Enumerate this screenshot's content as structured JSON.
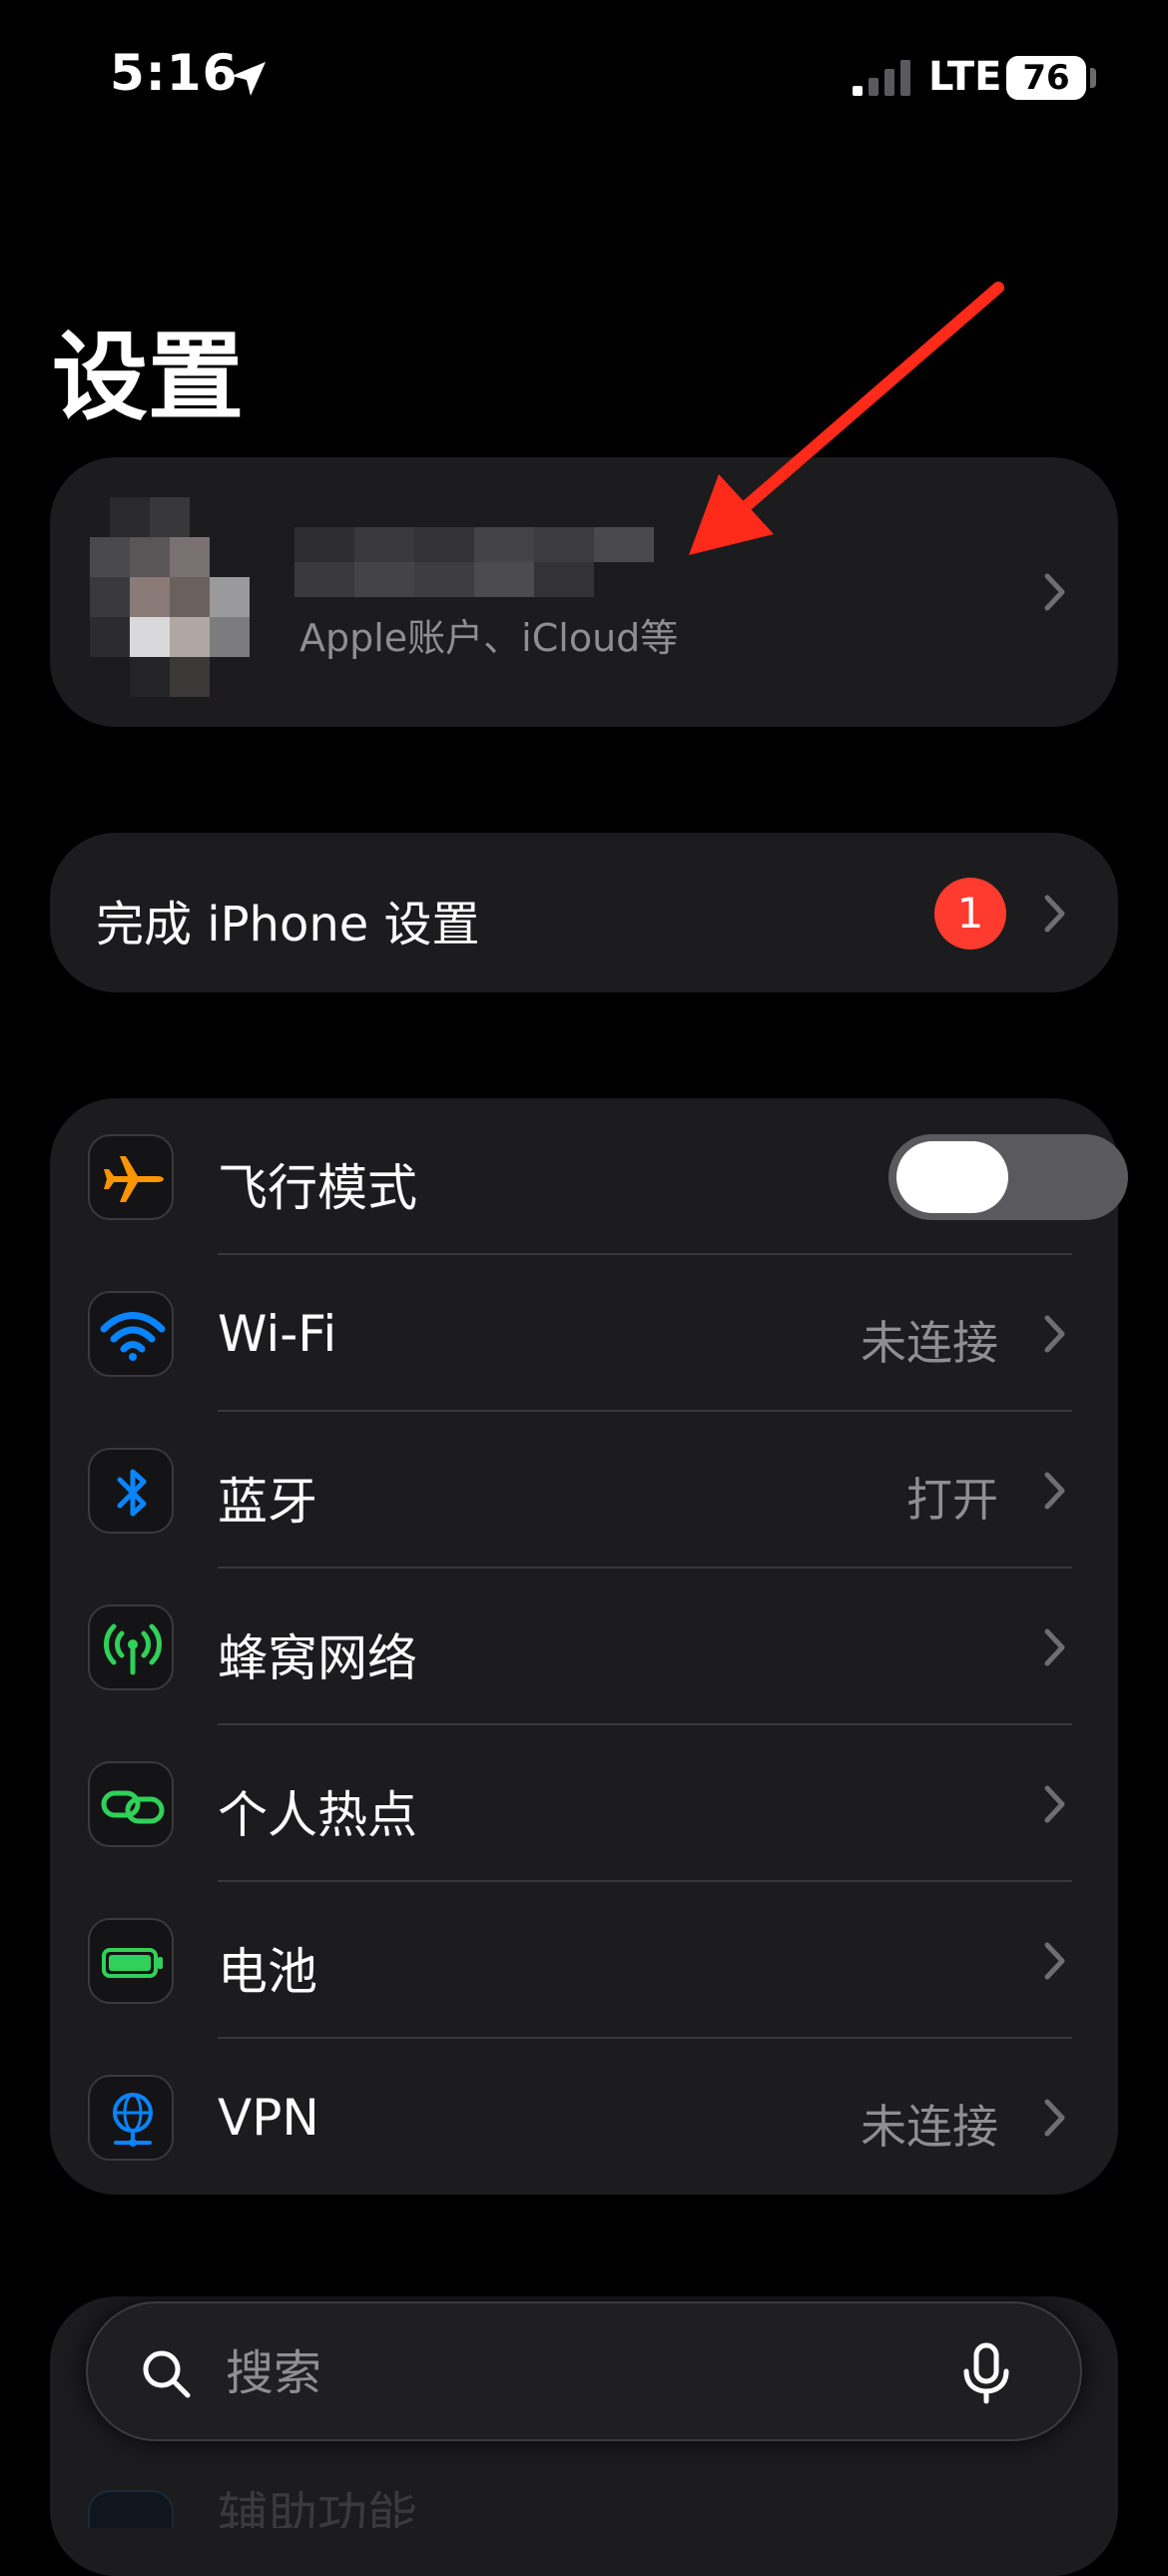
{
  "status_bar": {
    "time": "5:16",
    "network": "LTE",
    "battery_level": "76",
    "location_icon": "location-arrow-icon",
    "signal_icon": "cellular-signal-icon"
  },
  "header": {
    "title": "设置"
  },
  "account": {
    "subtitle": "Apple账户、iCloud等",
    "avatar_icon": "avatar-pixelated"
  },
  "setup": {
    "label": "完成 iPhone 设置",
    "badge_count": "1"
  },
  "settings": {
    "airplane": {
      "label": "飞行模式",
      "icon": "airplane-icon",
      "enabled": false
    },
    "wifi": {
      "label": "Wi-Fi",
      "value": "未连接",
      "icon": "wifi-icon"
    },
    "bluetooth": {
      "label": "蓝牙",
      "value": "打开",
      "icon": "bluetooth-icon"
    },
    "cellular": {
      "label": "蜂窝网络",
      "icon": "cellular-antenna-icon"
    },
    "hotspot": {
      "label": "个人热点",
      "icon": "hotspot-link-icon"
    },
    "battery": {
      "label": "电池",
      "icon": "battery-icon"
    },
    "vpn": {
      "label": "VPN",
      "value": "未连接",
      "icon": "vpn-globe-icon"
    }
  },
  "search": {
    "placeholder": "搜索",
    "search_icon": "search-icon",
    "mic_icon": "microphone-icon"
  },
  "partially_visible": {
    "label": "辅助功能"
  },
  "colors": {
    "background": "#000000",
    "card": "#1c1c1e",
    "secondary_text": "#8e8e93",
    "badge_red": "#ff3b30",
    "airplane_orange": "#ff9500",
    "wifi_blue": "#0a84ff",
    "cellular_green": "#30d158",
    "annotation_red": "#ff2a1a"
  }
}
